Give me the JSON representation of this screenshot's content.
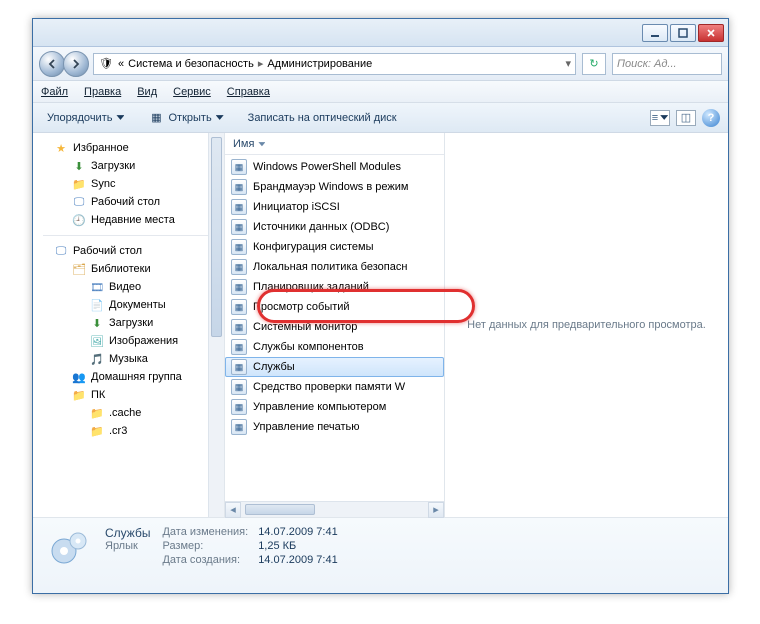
{
  "breadcrumb": {
    "prefix_icon": "arrows",
    "p1": "Система и безопасность",
    "p2": "Администрирование"
  },
  "search": {
    "placeholder": "Поиск: Ад..."
  },
  "menu": {
    "file": "Файл",
    "edit": "Правка",
    "view": "Вид",
    "tools": "Сервис",
    "help": "Справка"
  },
  "toolbar": {
    "organize": "Упорядочить",
    "open": "Открыть",
    "burn": "Записать на оптический диск"
  },
  "column": {
    "name": "Имя"
  },
  "sidebar": {
    "fav": "Избранное",
    "downloads": "Загрузки",
    "sync": "Sync",
    "desktop": "Рабочий стол",
    "recent": "Недавние места",
    "desktop2": "Рабочий стол",
    "libraries": "Библиотеки",
    "video": "Видео",
    "documents": "Документы",
    "downloads2": "Загрузки",
    "images": "Изображения",
    "music": "Музыка",
    "homegroup": "Домашняя группа",
    "pc": "ПК",
    "cache": ".cache",
    "cr3": ".cr3"
  },
  "files": {
    "i0": "Windows PowerShell Modules",
    "i1": "Брандмауэр Windows в режим",
    "i2": "Инициатор iSCSI",
    "i3": "Источники данных (ODBC)",
    "i4": "Конфигурация системы",
    "i5": "Локальная политика безопасн",
    "i6": "Планировщик заданий",
    "i7": "Просмотр событий",
    "i8": "Системный монитор",
    "i9": "Службы компонентов",
    "i10": "Службы",
    "i11": "Средство проверки памяти W",
    "i12": "Управление компьютером",
    "i13": "Управление печатью"
  },
  "preview": {
    "empty": "Нет данных для предварительного просмотра."
  },
  "details": {
    "title": "Службы",
    "type": "Ярлык",
    "k_mod": "Дата изменения:",
    "v_mod": "14.07.2009 7:41",
    "k_size": "Размер:",
    "v_size": "1,25 КБ",
    "k_created": "Дата создания:",
    "v_created": "14.07.2009 7:41"
  }
}
